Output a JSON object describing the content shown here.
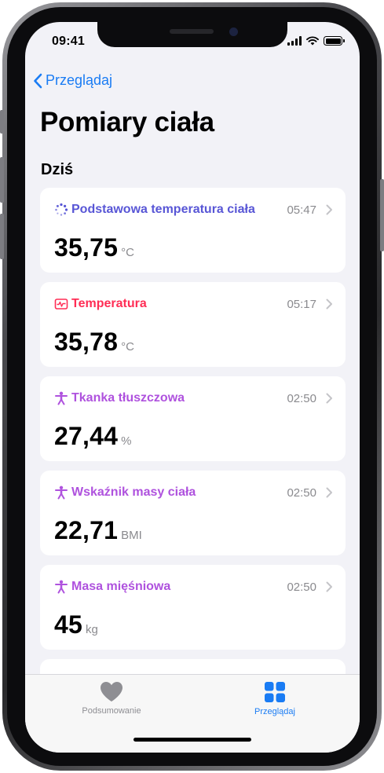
{
  "status_bar": {
    "time": "09:41"
  },
  "nav": {
    "back_label": "Przeglądaj"
  },
  "page": {
    "title": "Pomiary ciała",
    "section_title": "Dziś"
  },
  "cards": [
    {
      "label": "Podstawowa temperatura ciała",
      "time": "05:47",
      "value": "35,75",
      "unit": "°C",
      "icon": "sparkle-dots-icon",
      "color": "#5856d6"
    },
    {
      "label": "Temperatura",
      "time": "05:17",
      "value": "35,78",
      "unit": "°C",
      "icon": "thermometer-monitor-icon",
      "color": "#ff2d55"
    },
    {
      "label": "Tkanka tłuszczowa",
      "time": "02:50",
      "value": "27,44",
      "unit": "%",
      "icon": "person-figure-icon",
      "color": "#af52de"
    },
    {
      "label": "Wskaźnik masy ciała",
      "time": "02:50",
      "value": "22,71",
      "unit": "BMI",
      "icon": "person-figure-icon",
      "color": "#af52de"
    },
    {
      "label": "Masa mięśniowa",
      "time": "02:50",
      "value": "45",
      "unit": "kg",
      "icon": "person-figure-icon",
      "color": "#af52de"
    }
  ],
  "tab_bar": {
    "summary_label": "Podsumowanie",
    "browse_label": "Przeglądaj",
    "active": "browse",
    "inactive_color": "#8e8e93",
    "active_color": "#1a7cf4"
  }
}
